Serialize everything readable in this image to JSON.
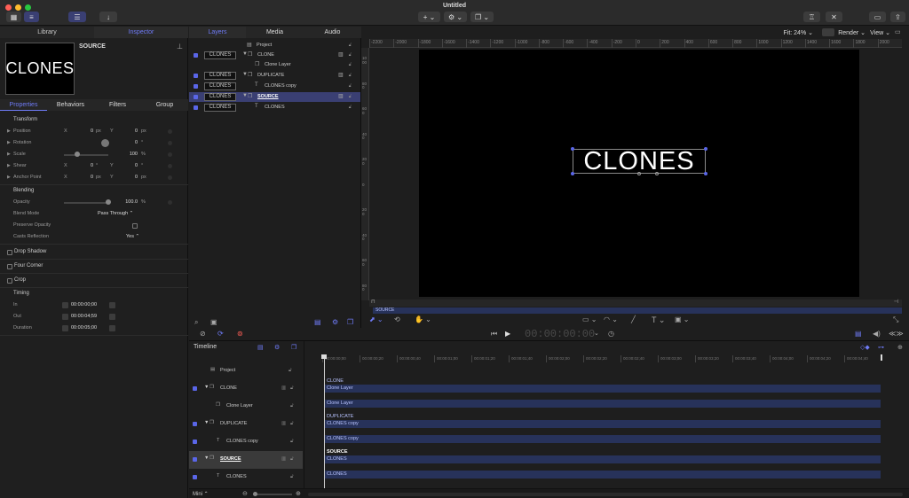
{
  "window": {
    "title": "Untitled"
  },
  "toolbar": {
    "fit_label": "Fit: 24%",
    "render_label": "Render",
    "view_label": "View"
  },
  "left_panel": {
    "tabs": [
      "Library",
      "Inspector"
    ],
    "thumbnail_text": "CLONES",
    "object_name": "SOURCE",
    "subtabs": [
      "Properties",
      "Behaviors",
      "Filters",
      "Group"
    ],
    "transform": {
      "title": "Transform",
      "rows": [
        {
          "label": "Position",
          "x": "0",
          "xu": "px",
          "y": "0",
          "yu": "px"
        },
        {
          "label": "Rotation",
          "v": "0",
          "u": "°"
        },
        {
          "label": "Scale",
          "v": "100",
          "u": "%"
        },
        {
          "label": "Shear",
          "x": "0",
          "xu": "°",
          "y": "0",
          "yu": "°"
        },
        {
          "label": "Anchor Point",
          "x": "0",
          "xu": "px",
          "y": "0",
          "yu": "px"
        }
      ],
      "axis_x": "X",
      "axis_y": "Y"
    },
    "blending": {
      "title": "Blending",
      "opacity_label": "Opacity",
      "opacity_value": "100.0",
      "opacity_unit": "%",
      "opacity_level": 1.0,
      "blend_mode_label": "Blend Mode",
      "blend_mode_value": "Pass Through",
      "preserve_opacity_label": "Preserve Opacity",
      "casts_reflection_label": "Casts Reflection",
      "casts_reflection_value": "Yes"
    },
    "toggles": [
      "Drop Shadow",
      "Four Corner",
      "Crop"
    ],
    "timing": {
      "title": "Timing",
      "rows": [
        {
          "label": "In",
          "value": "00:00:00;00"
        },
        {
          "label": "Out",
          "value": "00:00:04;59"
        },
        {
          "label": "Duration",
          "value": "00:00:05;00"
        }
      ]
    }
  },
  "layers_panel": {
    "tabs": [
      "Layers",
      "Media",
      "Audio"
    ],
    "rows": [
      {
        "name": "Project",
        "thumb": "",
        "indent": 1
      },
      {
        "name": "CLONE",
        "thumb": "CLONES",
        "indent": 0
      },
      {
        "name": "Clone Layer",
        "thumb": "",
        "indent": 2
      },
      {
        "name": "DUPLICATE",
        "thumb": "CLONES",
        "indent": 0
      },
      {
        "name": "CLONES copy",
        "thumb": "CLONES",
        "indent": 3
      },
      {
        "name": "SOURCE",
        "thumb": "CLONES",
        "indent": 0
      },
      {
        "name": "CLONES",
        "thumb": "CLONES",
        "indent": 3
      }
    ]
  },
  "canvas": {
    "ruler_h": [
      "-2200",
      "-2000",
      "-1800",
      "-1600",
      "-1400",
      "-1200",
      "-1000",
      "-800",
      "-600",
      "-400",
      "-200",
      "0",
      "200",
      "400",
      "600",
      "800",
      "1000",
      "1200",
      "1400",
      "1600",
      "1800",
      "2000"
    ],
    "ruler_v": [
      "1000",
      "800",
      "600",
      "400",
      "200",
      "0",
      "200",
      "400",
      "600",
      "800"
    ],
    "text": "CLONES",
    "mini_timeline_label": "SOURCE"
  },
  "transport": {
    "timecode": "00:00:00:00"
  },
  "timeline": {
    "title": "Timeline",
    "zoom_label": "Mini",
    "ruler": [
      "00:00:00;00",
      "00:00:00;20",
      "00:00:00;40",
      "00:00:01;00",
      "00:00:01;20",
      "00:00:01;40",
      "00:00:02;00",
      "00:00:02;20",
      "00:00:02;40",
      "00:00:03;00",
      "00:00:03;20",
      "00:00:03;40",
      "00:00:04;00",
      "00:00:04;20",
      "00:00:04;40"
    ],
    "rows": [
      {
        "name": "Project"
      },
      {
        "name": "CLONE"
      },
      {
        "name": "Clone Layer"
      },
      {
        "name": "DUPLICATE"
      },
      {
        "name": "CLONES copy"
      },
      {
        "name": "SOURCE"
      },
      {
        "name": "CLONES"
      }
    ],
    "bars": {
      "clone_label": "CLONE",
      "clone_bar": "Clone Layer",
      "clone_layer_bar": "Clone Layer",
      "duplicate_label": "DUPLICATE",
      "duplicate_bar": "CLONES copy",
      "clones_copy_bar": "CLONES copy",
      "source_label": "SOURCE",
      "source_bar": "CLONES",
      "clones_bar": "CLONES"
    }
  }
}
